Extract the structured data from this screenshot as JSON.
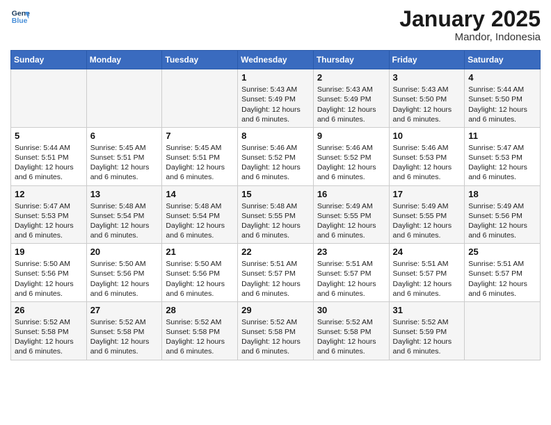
{
  "header": {
    "logo_line1": "General",
    "logo_line2": "Blue",
    "title": "January 2025",
    "subtitle": "Mandor, Indonesia"
  },
  "weekdays": [
    "Sunday",
    "Monday",
    "Tuesday",
    "Wednesday",
    "Thursday",
    "Friday",
    "Saturday"
  ],
  "weeks": [
    [
      {
        "day": "",
        "info": ""
      },
      {
        "day": "",
        "info": ""
      },
      {
        "day": "",
        "info": ""
      },
      {
        "day": "1",
        "info": "Sunrise: 5:43 AM\nSunset: 5:49 PM\nDaylight: 12 hours\nand 6 minutes."
      },
      {
        "day": "2",
        "info": "Sunrise: 5:43 AM\nSunset: 5:49 PM\nDaylight: 12 hours\nand 6 minutes."
      },
      {
        "day": "3",
        "info": "Sunrise: 5:43 AM\nSunset: 5:50 PM\nDaylight: 12 hours\nand 6 minutes."
      },
      {
        "day": "4",
        "info": "Sunrise: 5:44 AM\nSunset: 5:50 PM\nDaylight: 12 hours\nand 6 minutes."
      }
    ],
    [
      {
        "day": "5",
        "info": "Sunrise: 5:44 AM\nSunset: 5:51 PM\nDaylight: 12 hours\nand 6 minutes."
      },
      {
        "day": "6",
        "info": "Sunrise: 5:45 AM\nSunset: 5:51 PM\nDaylight: 12 hours\nand 6 minutes."
      },
      {
        "day": "7",
        "info": "Sunrise: 5:45 AM\nSunset: 5:51 PM\nDaylight: 12 hours\nand 6 minutes."
      },
      {
        "day": "8",
        "info": "Sunrise: 5:46 AM\nSunset: 5:52 PM\nDaylight: 12 hours\nand 6 minutes."
      },
      {
        "day": "9",
        "info": "Sunrise: 5:46 AM\nSunset: 5:52 PM\nDaylight: 12 hours\nand 6 minutes."
      },
      {
        "day": "10",
        "info": "Sunrise: 5:46 AM\nSunset: 5:53 PM\nDaylight: 12 hours\nand 6 minutes."
      },
      {
        "day": "11",
        "info": "Sunrise: 5:47 AM\nSunset: 5:53 PM\nDaylight: 12 hours\nand 6 minutes."
      }
    ],
    [
      {
        "day": "12",
        "info": "Sunrise: 5:47 AM\nSunset: 5:53 PM\nDaylight: 12 hours\nand 6 minutes."
      },
      {
        "day": "13",
        "info": "Sunrise: 5:48 AM\nSunset: 5:54 PM\nDaylight: 12 hours\nand 6 minutes."
      },
      {
        "day": "14",
        "info": "Sunrise: 5:48 AM\nSunset: 5:54 PM\nDaylight: 12 hours\nand 6 minutes."
      },
      {
        "day": "15",
        "info": "Sunrise: 5:48 AM\nSunset: 5:55 PM\nDaylight: 12 hours\nand 6 minutes."
      },
      {
        "day": "16",
        "info": "Sunrise: 5:49 AM\nSunset: 5:55 PM\nDaylight: 12 hours\nand 6 minutes."
      },
      {
        "day": "17",
        "info": "Sunrise: 5:49 AM\nSunset: 5:55 PM\nDaylight: 12 hours\nand 6 minutes."
      },
      {
        "day": "18",
        "info": "Sunrise: 5:49 AM\nSunset: 5:56 PM\nDaylight: 12 hours\nand 6 minutes."
      }
    ],
    [
      {
        "day": "19",
        "info": "Sunrise: 5:50 AM\nSunset: 5:56 PM\nDaylight: 12 hours\nand 6 minutes."
      },
      {
        "day": "20",
        "info": "Sunrise: 5:50 AM\nSunset: 5:56 PM\nDaylight: 12 hours\nand 6 minutes."
      },
      {
        "day": "21",
        "info": "Sunrise: 5:50 AM\nSunset: 5:56 PM\nDaylight: 12 hours\nand 6 minutes."
      },
      {
        "day": "22",
        "info": "Sunrise: 5:51 AM\nSunset: 5:57 PM\nDaylight: 12 hours\nand 6 minutes."
      },
      {
        "day": "23",
        "info": "Sunrise: 5:51 AM\nSunset: 5:57 PM\nDaylight: 12 hours\nand 6 minutes."
      },
      {
        "day": "24",
        "info": "Sunrise: 5:51 AM\nSunset: 5:57 PM\nDaylight: 12 hours\nand 6 minutes."
      },
      {
        "day": "25",
        "info": "Sunrise: 5:51 AM\nSunset: 5:57 PM\nDaylight: 12 hours\nand 6 minutes."
      }
    ],
    [
      {
        "day": "26",
        "info": "Sunrise: 5:52 AM\nSunset: 5:58 PM\nDaylight: 12 hours\nand 6 minutes."
      },
      {
        "day": "27",
        "info": "Sunrise: 5:52 AM\nSunset: 5:58 PM\nDaylight: 12 hours\nand 6 minutes."
      },
      {
        "day": "28",
        "info": "Sunrise: 5:52 AM\nSunset: 5:58 PM\nDaylight: 12 hours\nand 6 minutes."
      },
      {
        "day": "29",
        "info": "Sunrise: 5:52 AM\nSunset: 5:58 PM\nDaylight: 12 hours\nand 6 minutes."
      },
      {
        "day": "30",
        "info": "Sunrise: 5:52 AM\nSunset: 5:58 PM\nDaylight: 12 hours\nand 6 minutes."
      },
      {
        "day": "31",
        "info": "Sunrise: 5:52 AM\nSunset: 5:59 PM\nDaylight: 12 hours\nand 6 minutes."
      },
      {
        "day": "",
        "info": ""
      }
    ]
  ]
}
